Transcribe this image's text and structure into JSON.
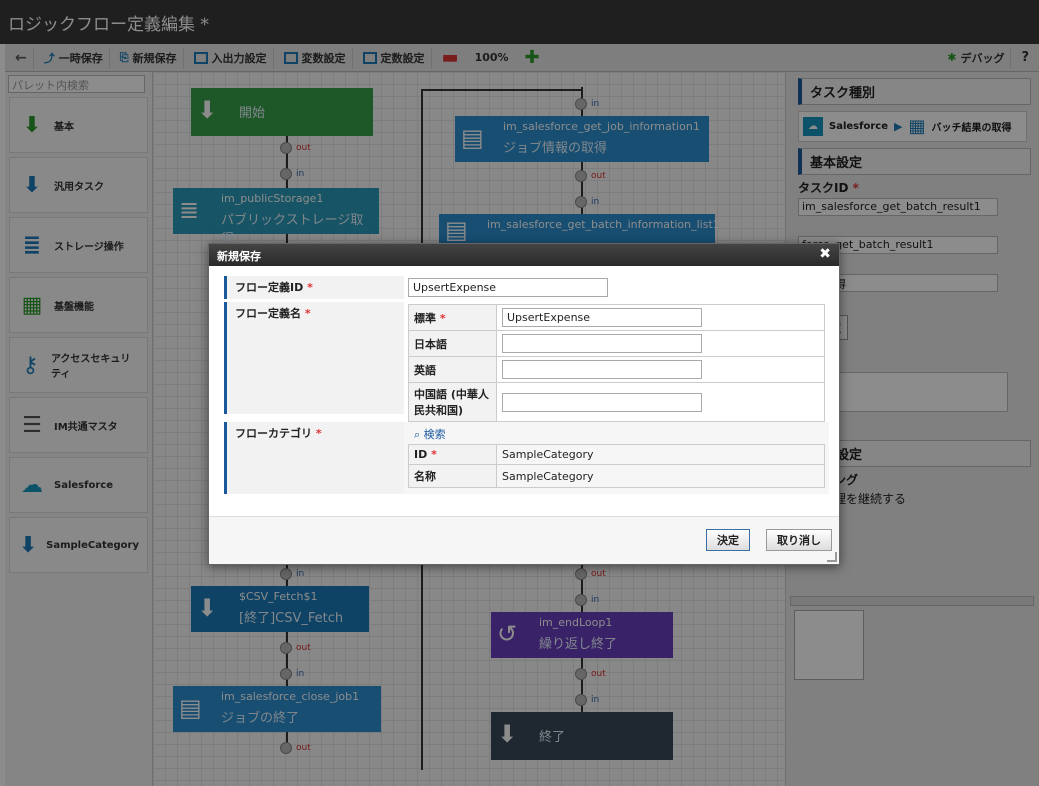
{
  "title": "ロジックフロー定義編集 *",
  "toolbar": {
    "back": "←",
    "temp_save": "一時保存",
    "new_save": "新規保存",
    "io_settings": "入出力設定",
    "variable_settings": "変数設定",
    "constant_settings": "定数設定",
    "zoom": "100%",
    "debug": "デバッグ",
    "help": "?"
  },
  "palette": {
    "search_placeholder": "パレット内検索",
    "items": [
      {
        "label": "基本",
        "icon": "down-arrow-icon",
        "color": "#2a9a2a"
      },
      {
        "label": "汎用タスク",
        "icon": "down-arrow-icon",
        "color": "#1a7ab8"
      },
      {
        "label": "ストレージ操作",
        "icon": "storage-icon",
        "color": "#1a7ab8"
      },
      {
        "label": "基盤機能",
        "icon": "grid-icon",
        "color": "#2a9a2a"
      },
      {
        "label": "アクセスセキュリティ",
        "icon": "key-icon",
        "color": "#1a7ab8"
      },
      {
        "label": "IM共通マスタ",
        "icon": "database-icon",
        "color": "#555"
      },
      {
        "label": "Salesforce",
        "icon": "salesforce-icon",
        "color": "#1798c1"
      },
      {
        "label": "SampleCategory",
        "icon": "down-arrow-icon",
        "color": "#1a7ab8"
      }
    ]
  },
  "canvas": {
    "nodes": {
      "start": {
        "name": "開始"
      },
      "public_storage": {
        "name": "im_publicStorage1",
        "sub": "パブリックストレージ取得"
      },
      "job_info": {
        "name": "im_salesforce_get_job_information1",
        "sub": "ジョブ情報の取得"
      },
      "batch_list": {
        "name": "im_salesforce_get_batch_information_list1"
      },
      "csv_fetch": {
        "name": "$CSV_Fetch$1",
        "sub": "[終了]CSV_Fetch"
      },
      "close_job": {
        "name": "im_salesforce_close_job1",
        "sub": "ジョブの終了"
      },
      "end_loop": {
        "name": "im_endLoop1",
        "sub": "繰り返し終了"
      },
      "end": {
        "name": "終了"
      }
    },
    "port_in": "in",
    "port_out": "out"
  },
  "right": {
    "task_type_header": "タスク種別",
    "salesforce_label": "Salesforce",
    "batch_result_label": "バッチ結果の取得",
    "basic_header": "基本設定",
    "task_id_label": "タスクID",
    "task_id_value": "im_salesforce_get_batch_result1",
    "alias_value": "force_get_batch_result1",
    "text_value": "果の取得",
    "debug_settings": "グ設定",
    "debug_btn": "グ設定",
    "specific_header": "固有設定",
    "handling_label": "ンドリング",
    "handling_text": "でも処理を継続する"
  },
  "dialog": {
    "title": "新規保存",
    "flow_id_label": "フロー定義ID",
    "flow_id_value": "UpsertExpense",
    "flow_name_label": "フロー定義名",
    "names": [
      {
        "lang": "標準",
        "required": true,
        "value": "UpsertExpense"
      },
      {
        "lang": "日本語",
        "required": false,
        "value": ""
      },
      {
        "lang": "英語",
        "required": false,
        "value": ""
      },
      {
        "lang": "中国語 (中華人民共和国)",
        "required": false,
        "value": ""
      }
    ],
    "category_label": "フローカテゴリ",
    "search_link": "検索",
    "category_id_label": "ID",
    "category_id_value": "SampleCategory",
    "category_name_label": "名称",
    "category_name_value": "SampleCategory",
    "ok_button": "決定",
    "cancel_button": "取り消し",
    "required_mark": "*"
  }
}
